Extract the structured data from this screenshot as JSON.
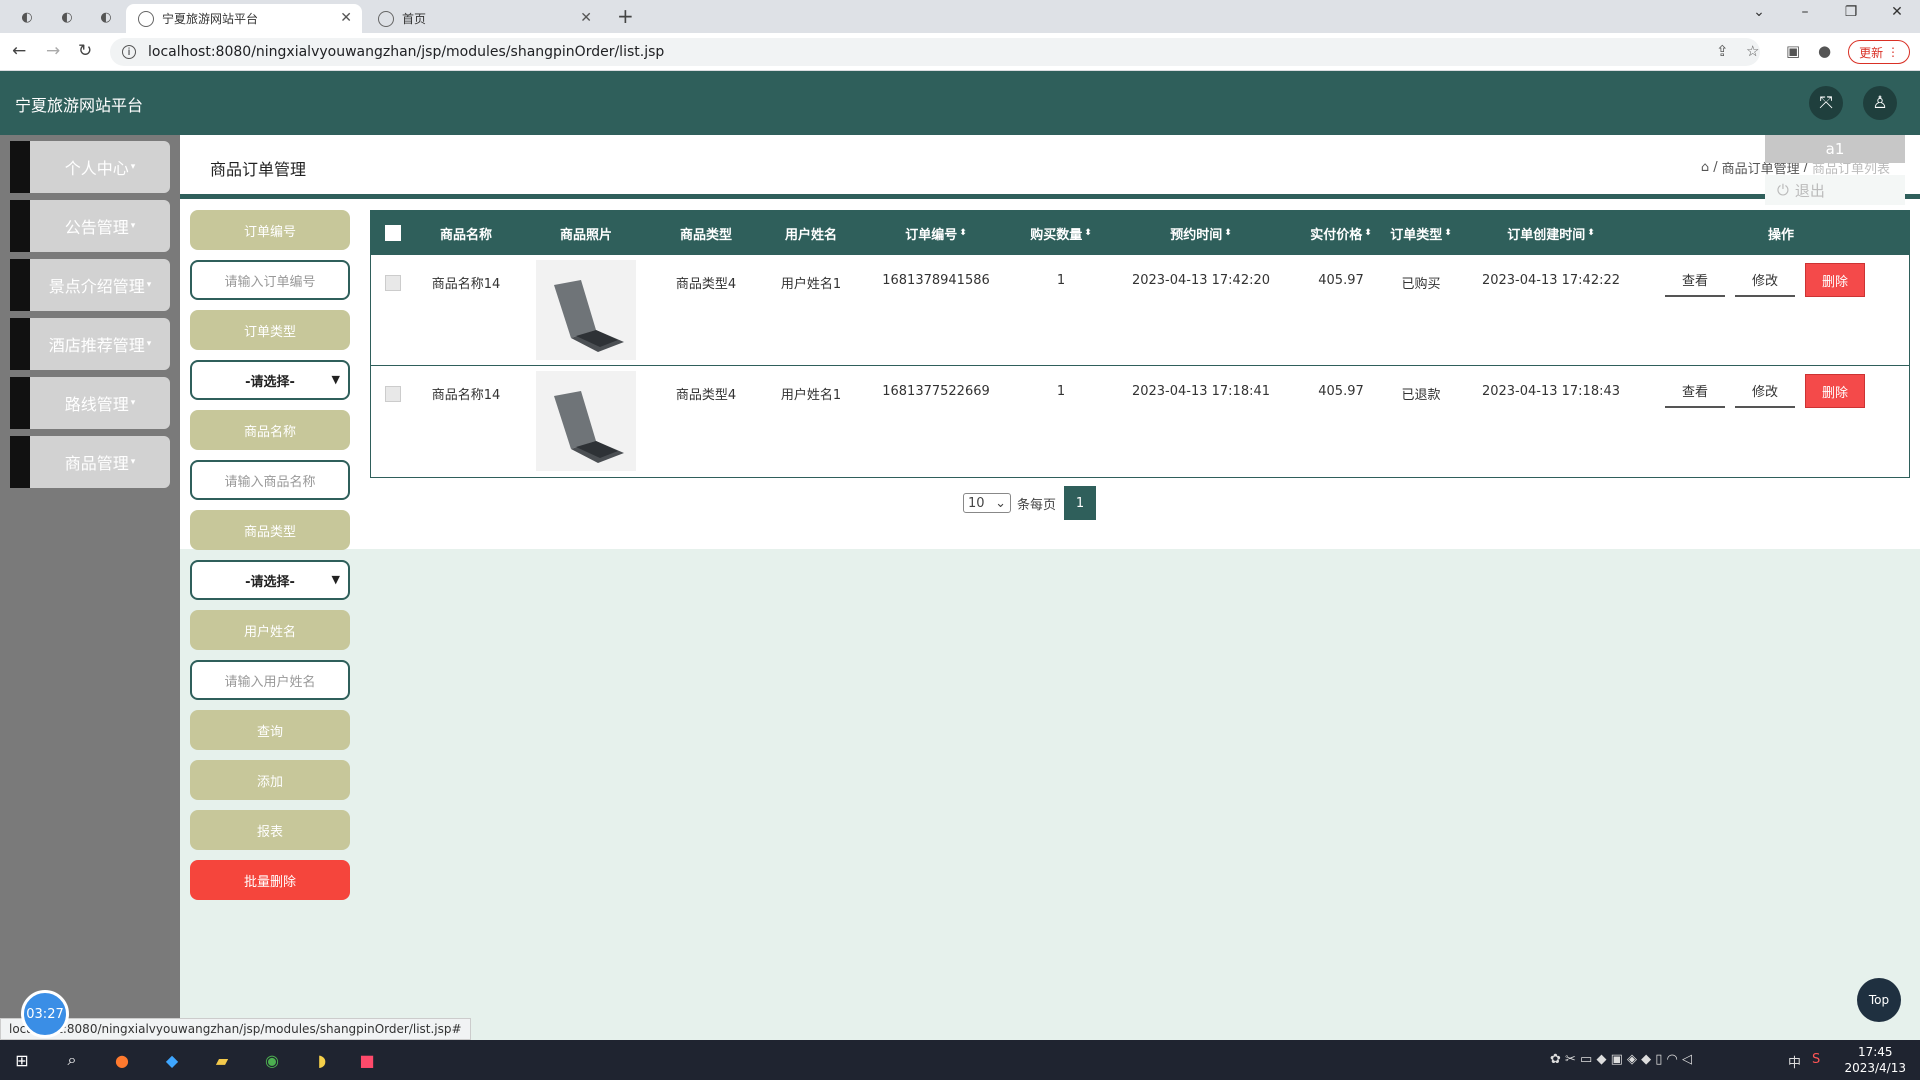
{
  "browser": {
    "tabs": [
      {
        "title": "宁夏旅游网站平台",
        "active": true
      },
      {
        "title": "首页",
        "active": false
      }
    ],
    "url": "localhost:8080/ningxialvyouwangzhan/jsp/modules/shangpinOrder/list.jsp",
    "update_label": "更新"
  },
  "app": {
    "title": "宁夏旅游网站平台"
  },
  "sidebar": {
    "items": [
      {
        "label": "个人中心"
      },
      {
        "label": "公告管理"
      },
      {
        "label": "景点介绍管理"
      },
      {
        "label": "酒店推荐管理"
      },
      {
        "label": "路线管理"
      },
      {
        "label": "商品管理"
      }
    ]
  },
  "page": {
    "title": "商品订单管理",
    "breadcrumb": [
      "商品订单管理",
      "商品订单列表"
    ]
  },
  "user_menu": {
    "username": "a1",
    "logout": "退出"
  },
  "filters": {
    "order_no_label": "订单编号",
    "order_no_placeholder": "请输入订单编号",
    "order_type_label": "订单类型",
    "order_type_value": "-请选择-",
    "goods_name_label": "商品名称",
    "goods_name_placeholder": "请输入商品名称",
    "goods_type_label": "商品类型",
    "goods_type_value": "-请选择-",
    "user_name_label": "用户姓名",
    "user_name_placeholder": "请输入用户姓名",
    "query": "查询",
    "add": "添加",
    "report": "报表",
    "batch_delete": "批量删除"
  },
  "table": {
    "headers": [
      "商品名称",
      "商品照片",
      "商品类型",
      "用户姓名",
      "订单编号",
      "购买数量",
      "预约时间",
      "实付价格",
      "订单类型",
      "订单创建时间",
      "操作"
    ],
    "sortable": [
      false,
      false,
      false,
      false,
      true,
      true,
      true,
      true,
      true,
      true,
      false
    ],
    "rows": [
      {
        "name": "商品名称14",
        "type": "商品类型4",
        "user": "用户姓名1",
        "order_no": "1681378941586",
        "qty": "1",
        "reserve_time": "2023-04-13 17:42:20",
        "price": "405.97",
        "order_type": "已购买",
        "created": "2023-04-13 17:42:22"
      },
      {
        "name": "商品名称14",
        "type": "商品类型4",
        "user": "用户姓名1",
        "order_no": "1681377522669",
        "qty": "1",
        "reserve_time": "2023-04-13 17:18:41",
        "price": "405.97",
        "order_type": "已退款",
        "created": "2023-04-13 17:18:43"
      }
    ],
    "actions": {
      "view": "查看",
      "edit": "修改",
      "delete": "删除"
    }
  },
  "pager": {
    "page_size": "10",
    "per_page_label": "条每页",
    "current_page": "1"
  },
  "top_button": "Top",
  "status_url": "localhost:8080/ningxialvyouwangzhan/jsp/modules/shangpinOrder/list.jsp#",
  "clock_bubble": "03:27",
  "taskbar": {
    "time": "17:45",
    "date": "2023/4/13",
    "ime": "中"
  }
}
